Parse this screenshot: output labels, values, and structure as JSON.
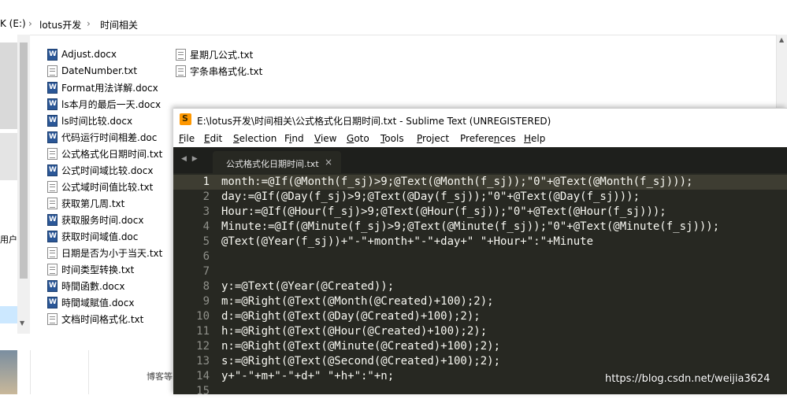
{
  "explorer": {
    "breadcrumb": [
      "K (E:)",
      "lotus开发",
      "时间相关"
    ],
    "nav_partial_label": "用户",
    "files_col1": [
      {
        "name": "Adjust.docx",
        "type": "docx"
      },
      {
        "name": "DateNumber.txt",
        "type": "txt"
      },
      {
        "name": "Format用法详解.docx",
        "type": "docx"
      },
      {
        "name": "ls本月的最后一天.docx",
        "type": "docx"
      },
      {
        "name": "ls时间比较.docx",
        "type": "docx"
      },
      {
        "name": "代码运行时间相差.doc",
        "type": "docx"
      },
      {
        "name": "公式格式化日期时间.txt",
        "type": "txt"
      },
      {
        "name": "公式时间域比较.docx",
        "type": "docx"
      },
      {
        "name": "公式域时间值比较.txt",
        "type": "txt"
      },
      {
        "name": "获取第几周.txt",
        "type": "txt"
      },
      {
        "name": "获取服务时间.docx",
        "type": "docx"
      },
      {
        "name": "获取时间域值.doc",
        "type": "docx"
      },
      {
        "name": "日期是否为小于当天.txt",
        "type": "txt"
      },
      {
        "name": "时间类型转换.txt",
        "type": "txt"
      },
      {
        "name": "時間函數.docx",
        "type": "docx"
      },
      {
        "name": "時間域賦值.docx",
        "type": "docx"
      },
      {
        "name": "文档时间格式化.txt",
        "type": "txt"
      }
    ],
    "files_col2": [
      {
        "name": "星期几公式.txt",
        "type": "txt"
      },
      {
        "name": "字条串格式化.txt",
        "type": "txt"
      }
    ],
    "footer_partial": "博客等"
  },
  "sublime": {
    "title": "E:\\lotus开发\\时间相关\\公式格式化日期时间.txt - Sublime Text (UNREGISTERED)",
    "menu": [
      {
        "pre": "",
        "u": "F",
        "post": "ile"
      },
      {
        "pre": "",
        "u": "E",
        "post": "dit"
      },
      {
        "pre": "",
        "u": "S",
        "post": "election"
      },
      {
        "pre": "F",
        "u": "i",
        "post": "nd"
      },
      {
        "pre": "",
        "u": "V",
        "post": "iew"
      },
      {
        "pre": "",
        "u": "G",
        "post": "oto"
      },
      {
        "pre": "",
        "u": "T",
        "post": "ools"
      },
      {
        "pre": "",
        "u": "P",
        "post": "roject"
      },
      {
        "pre": "Prefere",
        "u": "n",
        "post": "ces"
      },
      {
        "pre": "",
        "u": "H",
        "post": "elp"
      }
    ],
    "nav_arrows": "◀ ▶",
    "tab_label": "公式格式化日期时间.txt",
    "tab_close": "×",
    "lines": [
      {
        "n": "1",
        "text": "month:=@If(@Month(f_sj)>9;@Text(@Month(f_sj));\"0\"+@Text(@Month(f_sj)));"
      },
      {
        "n": "2",
        "text": "day:=@If(@Day(f_sj)>9;@Text(@Day(f_sj));\"0\"+@Text(@Day(f_sj)));"
      },
      {
        "n": "3",
        "text": "Hour:=@If(@Hour(f_sj)>9;@Text(@Hour(f_sj));\"0\"+@Text(@Hour(f_sj)));"
      },
      {
        "n": "4",
        "text": "Minute:=@If(@Minute(f_sj)>9;@Text(@Minute(f_sj));\"0\"+@Text(@Minute(f_sj)));"
      },
      {
        "n": "5",
        "text": "@Text(@Year(f_sj))+\"-\"+month+\"-\"+day+\" \"+Hour+\":\"+Minute"
      },
      {
        "n": "6",
        "text": ""
      },
      {
        "n": "7",
        "text": ""
      },
      {
        "n": "8",
        "text": "y:=@Text(@Year(@Created));"
      },
      {
        "n": "9",
        "text": "m:=@Right(@Text(@Month(@Created)+100);2);"
      },
      {
        "n": "10",
        "text": "d:=@Right(@Text(@Day(@Created)+100);2);"
      },
      {
        "n": "11",
        "text": "h:=@Right(@Text(@Hour(@Created)+100);2);"
      },
      {
        "n": "12",
        "text": "n:=@Right(@Text(@Minute(@Created)+100);2);"
      },
      {
        "n": "13",
        "text": "s:=@Right(@Text(@Second(@Created)+100);2);"
      },
      {
        "n": "14",
        "text": "y+\"-\"+m+\"-\"+d+\" \"+h+\":\"+n;"
      },
      {
        "n": "15",
        "text": ""
      }
    ]
  },
  "watermark": "https://blog.csdn.net/weijia3624"
}
